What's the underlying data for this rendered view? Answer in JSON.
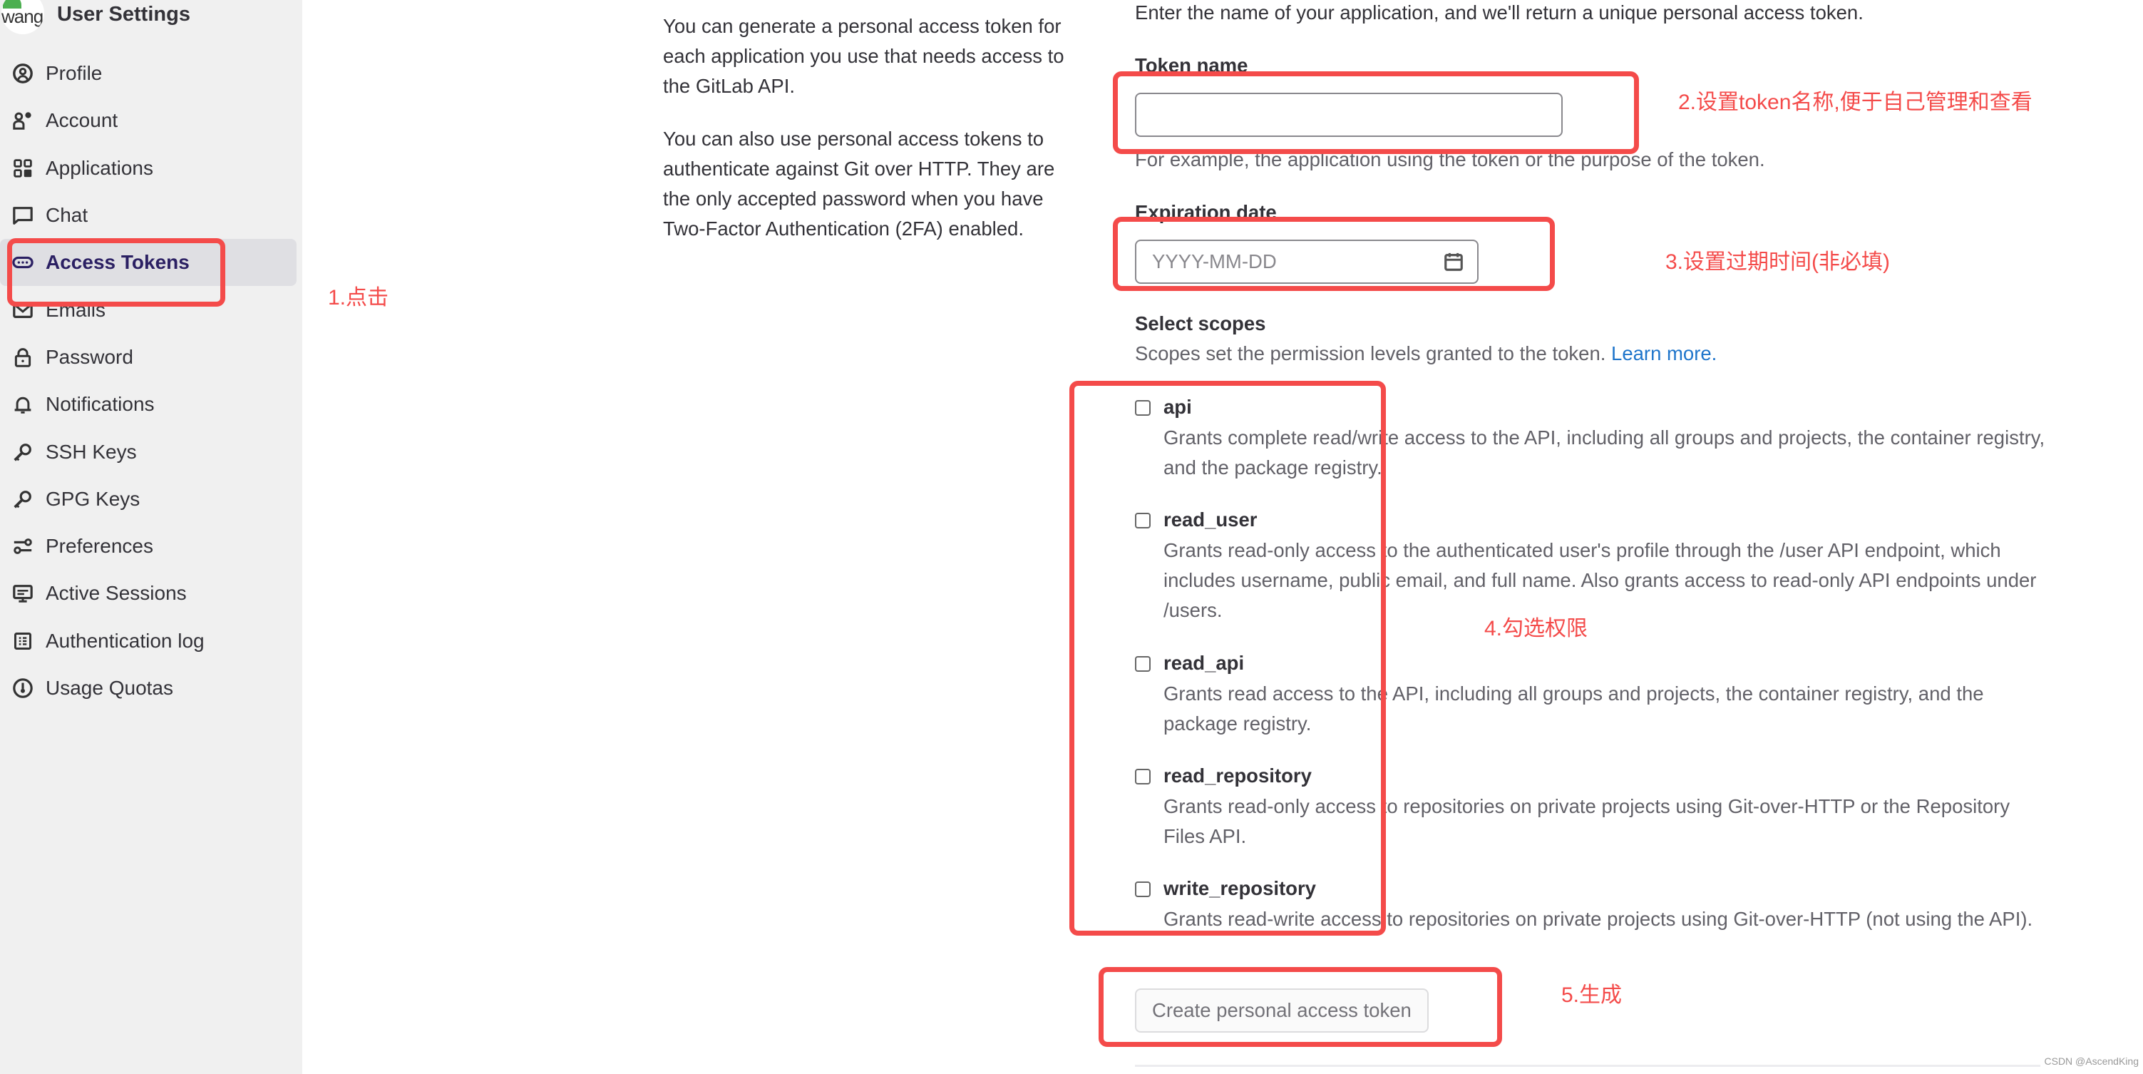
{
  "sidebar": {
    "title": "User Settings",
    "avatar_alt": "wang",
    "items": [
      {
        "label": "Profile",
        "icon": "profile-icon"
      },
      {
        "label": "Account",
        "icon": "account-icon"
      },
      {
        "label": "Applications",
        "icon": "applications-icon"
      },
      {
        "label": "Chat",
        "icon": "chat-icon"
      },
      {
        "label": "Access Tokens",
        "icon": "token-icon",
        "active": true
      },
      {
        "label": "Emails",
        "icon": "email-icon"
      },
      {
        "label": "Password",
        "icon": "lock-icon"
      },
      {
        "label": "Notifications",
        "icon": "bell-icon"
      },
      {
        "label": "SSH Keys",
        "icon": "key-icon"
      },
      {
        "label": "GPG Keys",
        "icon": "key-icon"
      },
      {
        "label": "Preferences",
        "icon": "preferences-icon"
      },
      {
        "label": "Active Sessions",
        "icon": "monitor-icon"
      },
      {
        "label": "Authentication log",
        "icon": "log-icon"
      },
      {
        "label": "Usage Quotas",
        "icon": "quota-icon"
      }
    ]
  },
  "description": {
    "p1": "You can generate a personal access token for each application you use that needs access to the GitLab API.",
    "p2": "You can also use personal access tokens to authenticate against Git over HTTP. They are the only accepted password when you have Two-Factor Authentication (2FA) enabled."
  },
  "form": {
    "intro": "Enter the name of your application, and we'll return a unique personal access token.",
    "token_name_label": "Token name",
    "token_name_value": "",
    "token_name_help": "For example, the application using the token or the purpose of the token.",
    "expiration_label": "Expiration date",
    "expiration_placeholder": "YYYY-MM-DD",
    "scopes_label": "Select scopes",
    "scopes_help": "Scopes set the permission levels granted to the token.",
    "learn_more": "Learn more.",
    "scopes": [
      {
        "name": "api",
        "checked": false,
        "description": "Grants complete read/write access to the API, including all groups and projects, the container registry, and the package registry."
      },
      {
        "name": "read_user",
        "checked": false,
        "description": "Grants read-only access to the authenticated user's profile through the /user API endpoint, which includes username, public email, and full name. Also grants access to read-only API endpoints under /users."
      },
      {
        "name": "read_api",
        "checked": false,
        "description": "Grants read access to the API, including all groups and projects, the container registry, and the package registry."
      },
      {
        "name": "read_repository",
        "checked": false,
        "description": "Grants read-only access to repositories on private projects using Git-over-HTTP or the Repository Files API."
      },
      {
        "name": "write_repository",
        "checked": false,
        "description": "Grants read-write access to repositories on private projects using Git-over-HTTP (not using the API)."
      }
    ],
    "submit_label": "Create personal access token"
  },
  "annotations": {
    "step1": "1.点击",
    "step2": "2.设置token名称,便于自己管理和查看",
    "step3": "3.设置过期时间(非必填)",
    "step4": "4.勾选权限",
    "step5": "5.生成",
    "color": "#f44b4a"
  },
  "watermark": "CSDN @AscendKing"
}
